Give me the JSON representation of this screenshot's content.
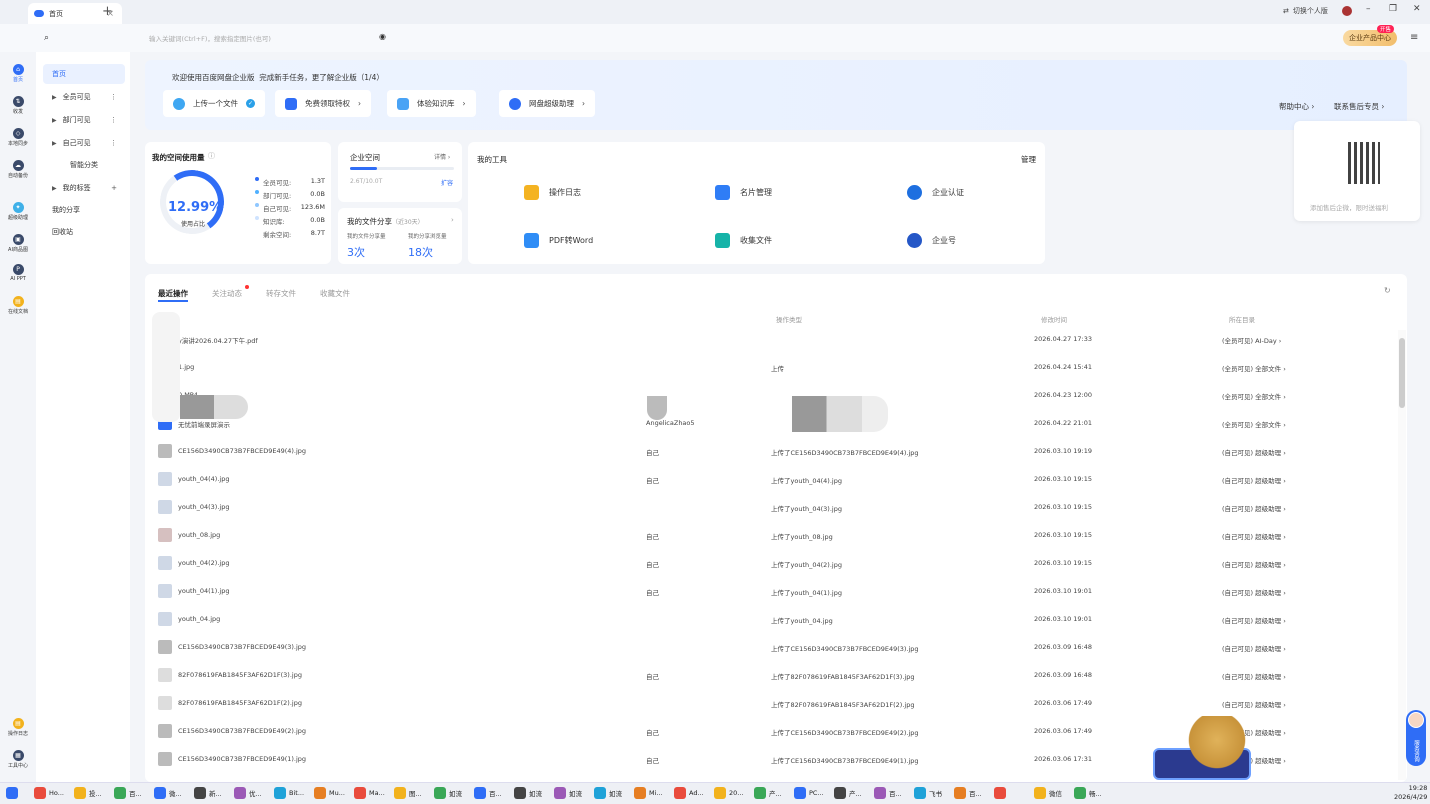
{
  "tab": {
    "title": "首页",
    "close": "×",
    "new": "+"
  },
  "titlebar": {
    "switch_account": "切换个人版",
    "min": "–",
    "max": "❐",
    "close": "✕"
  },
  "search": {
    "placeholder": "输入关键词(Ctrl+F)，搜索指定图片(也可)"
  },
  "enterprise": {
    "label": "企业产品中心",
    "badge": "开售"
  },
  "rail": [
    {
      "label": "首页"
    },
    {
      "label": "收发"
    },
    {
      "label": "本地同步"
    },
    {
      "label": "自动备份"
    },
    {
      "label": "超级助理"
    },
    {
      "label": "AI商品图"
    },
    {
      "label": "AI PPT"
    },
    {
      "label": "在线文档"
    },
    {
      "label": "操作日志"
    },
    {
      "label": "工具中心"
    }
  ],
  "sidebar": [
    {
      "label": "首页"
    },
    {
      "label": "全员可见"
    },
    {
      "label": "部门可见"
    },
    {
      "label": "自己可见"
    },
    {
      "label": "智能分类"
    },
    {
      "label": "我的标签"
    },
    {
      "label": "我的分享"
    },
    {
      "label": "回收站"
    }
  ],
  "banner": {
    "title": "欢迎使用百度网盘企业版",
    "task_text": "完成新手任务，更了解企业版（1/4）",
    "tasks": [
      {
        "label": "上传一个文件"
      },
      {
        "label": "免费领取特权"
      },
      {
        "label": "体验知识库"
      },
      {
        "label": "网盘超级助理"
      }
    ],
    "help": "帮助中心",
    "service": "联系售后专员"
  },
  "qr_popup": {
    "text": "添加售后企微，限时送福利"
  },
  "space": {
    "title": "我的空间使用量",
    "percent": "12.99%",
    "percent_label": "使用占比",
    "legend": [
      {
        "label": "全员可见:",
        "value": "1.3T",
        "color": "#2f6df6"
      },
      {
        "label": "部门可见:",
        "value": "0.0B",
        "color": "#4fb0ff"
      },
      {
        "label": "自己可见:",
        "value": "123.6M",
        "color": "#8fc7ff"
      },
      {
        "label": "知识库:",
        "value": "0.0B",
        "color": "#cfe3ff"
      },
      {
        "label": "剩余空间:",
        "value": "8.7T",
        "color": "#eef1f6"
      }
    ]
  },
  "enterprise_space": {
    "title": "企业空间",
    "detail": "详情",
    "usage": "2.6T/10.0T",
    "expand": "扩容",
    "ratio": 0.26
  },
  "share": {
    "title": "我的文件分享",
    "period": "（近30天）",
    "a_label": "我的文件分享量",
    "a_value": "3次",
    "b_label": "我的分享浏览量",
    "b_value": "18次"
  },
  "tools": {
    "title": "我的工具",
    "manage": "管理",
    "items": [
      {
        "label": "操作日志",
        "color": "#f4b322"
      },
      {
        "label": "名片管理",
        "color": "#2f7df6"
      },
      {
        "label": "企业认证",
        "color": "#1e6fe0"
      },
      {
        "label": "PDF转Word",
        "color": "#2f8df6"
      },
      {
        "label": "收集文件",
        "color": "#16b3a8"
      },
      {
        "label": "企业号",
        "color": "#2557c7"
      }
    ]
  },
  "list": {
    "tabs": [
      "最近操作",
      "关注动态",
      "转存文件",
      "收藏文件"
    ],
    "headers": [
      "操作类型",
      "修改时间",
      "所在目录"
    ],
    "rows": [
      {
        "name": "y演讲2026.04.27下午.pdf",
        "by": "",
        "action": "",
        "time": "2026.04.27 17:33",
        "dir": "(全员可见) AI-Day"
      },
      {
        "name": "1.jpg",
        "by": "",
        "action": "上传",
        "time": "2026.04.24 15:41",
        "dir": "(全员可见) 全部文件"
      },
      {
        "name": "0.MP4",
        "by": "",
        "action": "",
        "time": "2026.04.23 12:00",
        "dir": "(全员可见) 全部文件"
      },
      {
        "name": "无忧前端录屏演示",
        "by": "AngelicaZhao5",
        "action": "",
        "time": "2026.04.22 21:01",
        "dir": "(全员可见) 全部文件"
      },
      {
        "name": "CE156D3490CB73B7FBCED9E49(4).jpg",
        "by": "自己",
        "action": "上传了CE156D3490CB73B7FBCED9E49(4).jpg",
        "time": "2026.03.10 19:19",
        "dir": "(自己可见) 超级助理"
      },
      {
        "name": "youth_04(4).jpg",
        "by": "自己",
        "action": "上传了youth_04(4).jpg",
        "time": "2026.03.10 19:15",
        "dir": "(自己可见) 超级助理"
      },
      {
        "name": "youth_04(3).jpg",
        "by": "",
        "action": "上传了youth_04(3).jpg",
        "time": "2026.03.10 19:15",
        "dir": "(自己可见) 超级助理"
      },
      {
        "name": "youth_08.jpg",
        "by": "自己",
        "action": "上传了youth_08.jpg",
        "time": "2026.03.10 19:15",
        "dir": "(自己可见) 超级助理"
      },
      {
        "name": "youth_04(2).jpg",
        "by": "自己",
        "action": "上传了youth_04(2).jpg",
        "time": "2026.03.10 19:15",
        "dir": "(自己可见) 超级助理"
      },
      {
        "name": "youth_04(1).jpg",
        "by": "自己",
        "action": "上传了youth_04(1).jpg",
        "time": "2026.03.10 19:01",
        "dir": "(自己可见) 超级助理"
      },
      {
        "name": "youth_04.jpg",
        "by": "",
        "action": "上传了youth_04.jpg",
        "time": "2026.03.10 19:01",
        "dir": "(自己可见) 超级助理"
      },
      {
        "name": "CE156D3490CB73B7FBCED9E49(3).jpg",
        "by": "",
        "action": "上传了CE156D3490CB73B7FBCED9E49(3).jpg",
        "time": "2026.03.09 16:48",
        "dir": "(自己可见) 超级助理"
      },
      {
        "name": "82F078619FAB1845F3AF62D1F(3).jpg",
        "by": "自己",
        "action": "上传了82F078619FAB1845F3AF62D1F(3).jpg",
        "time": "2026.03.09 16:48",
        "dir": "(自己可见) 超级助理"
      },
      {
        "name": "82F078619FAB1845F3AF62D1F(2).jpg",
        "by": "",
        "action": "上传了82F078619FAB1845F3AF62D1F(2).jpg",
        "time": "2026.03.06 17:49",
        "dir": "(自己可见) 超级助理"
      },
      {
        "name": "CE156D3490CB73B7FBCED9E49(2).jpg",
        "by": "自己",
        "action": "上传了CE156D3490CB73B7FBCED9E49(2).jpg",
        "time": "2026.03.06 17:49",
        "dir": "(自己可见) 超级助理"
      },
      {
        "name": "CE156D3490CB73B7FBCED9E49(1).jpg",
        "by": "自己",
        "action": "上传了CE156D3490CB73B7FBCED9E49(1).jpg",
        "time": "2026.03.06 17:31",
        "dir": "(自己可见) 超级助理"
      }
    ]
  },
  "assistant": {
    "label": "服务咨询"
  },
  "taskbar": {
    "items": [
      "Ho...",
      "投...",
      "百...",
      "微...",
      "新...",
      "优...",
      "Bit...",
      "Mu...",
      "Ma...",
      "图...",
      "如流",
      "百...",
      "如流",
      "如流",
      "如流",
      "Mi...",
      "Ad...",
      "20...",
      "产...",
      "PC...",
      "产...",
      "百...",
      "飞书",
      "百...",
      " ",
      "微信",
      "畅..."
    ],
    "time": "19:28",
    "date": "2026/4/29"
  }
}
